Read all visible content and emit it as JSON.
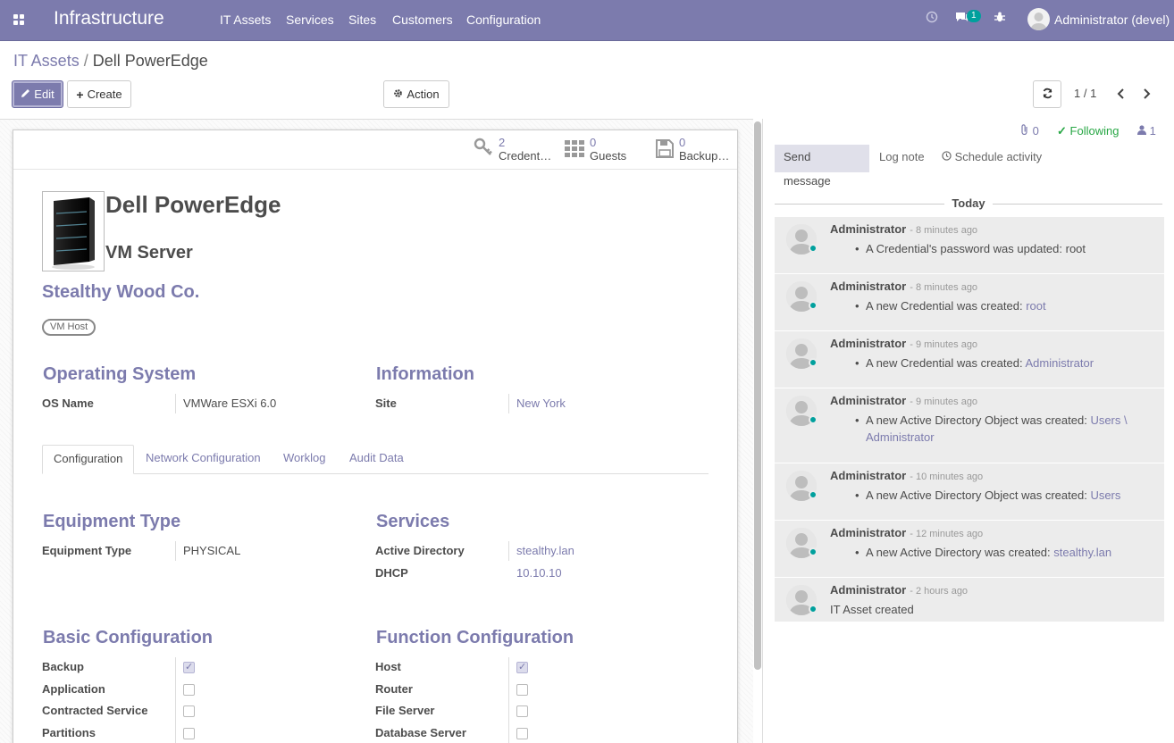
{
  "navbar": {
    "brand": "Infrastructure",
    "menu": [
      "IT Assets",
      "Services",
      "Sites",
      "Customers",
      "Configuration"
    ],
    "message_count": "1",
    "user": "Administrator (devel)"
  },
  "breadcrumb": {
    "parent": "IT Assets",
    "separator": "/",
    "current": "Dell PowerEdge"
  },
  "buttons": {
    "edit": "Edit",
    "create": "Create",
    "action": "Action"
  },
  "pager": {
    "value": "1 / 1"
  },
  "stats": [
    {
      "num": "2",
      "label": "Credent…"
    },
    {
      "num": "0",
      "label": "Guests"
    },
    {
      "num": "0",
      "label": "Backup…"
    }
  ],
  "record": {
    "name": "Dell PowerEdge",
    "subtitle": "VM Server",
    "partner": "Stealthy Wood Co.",
    "tag": "VM Host"
  },
  "groups": {
    "os": {
      "title": "Operating System",
      "label": "OS Name",
      "value": "VMWare ESXi 6.0"
    },
    "info": {
      "title": "Information",
      "label": "Site",
      "value": "New York"
    }
  },
  "tabs": [
    "Configuration",
    "Network Configuration",
    "Worklog",
    "Audit Data"
  ],
  "equipment": {
    "title": "Equipment Type",
    "label": "Equipment Type",
    "value": "PHYSICAL"
  },
  "services": {
    "title": "Services",
    "rows": [
      {
        "label": "Active Directory",
        "value": "stealthy.lan"
      },
      {
        "label": "DHCP",
        "value": "10.10.10"
      }
    ]
  },
  "basic_config": {
    "title": "Basic Configuration",
    "rows": [
      {
        "label": "Backup",
        "checked": true
      },
      {
        "label": "Application",
        "checked": false
      },
      {
        "label": "Contracted Service",
        "checked": false
      },
      {
        "label": "Partitions",
        "checked": false
      }
    ]
  },
  "function_config": {
    "title": "Function Configuration",
    "rows": [
      {
        "label": "Host",
        "checked": true
      },
      {
        "label": "Router",
        "checked": false
      },
      {
        "label": "File Server",
        "checked": false
      },
      {
        "label": "Database Server",
        "checked": false
      }
    ]
  },
  "chatter": {
    "attachments": "0",
    "following": "Following",
    "followers": "1",
    "send_message": "Send message",
    "log_note": "Log note",
    "schedule_activity": "Schedule activity",
    "today": "Today",
    "messages": [
      {
        "author": "Administrator",
        "date": "- 8 minutes ago",
        "text": "A Credential's password was updated: root",
        "link": ""
      },
      {
        "author": "Administrator",
        "date": "- 8 minutes ago",
        "text": "A new Credential was created: ",
        "link": "root"
      },
      {
        "author": "Administrator",
        "date": "- 9 minutes ago",
        "text": "A new Credential was created: ",
        "link": "Administrator"
      },
      {
        "author": "Administrator",
        "date": "- 9 minutes ago",
        "text": "A new Active Directory Object was created: ",
        "link": "Users \\ Administrator"
      },
      {
        "author": "Administrator",
        "date": "- 10 minutes ago",
        "text": "A new Active Directory Object was created: ",
        "link": "Users"
      },
      {
        "author": "Administrator",
        "date": "- 12 minutes ago",
        "text": "A new Active Directory was created: ",
        "link": "stealthy.lan"
      },
      {
        "author": "Administrator",
        "date": "- 2 hours ago",
        "text": "IT Asset created",
        "link": ""
      }
    ]
  }
}
